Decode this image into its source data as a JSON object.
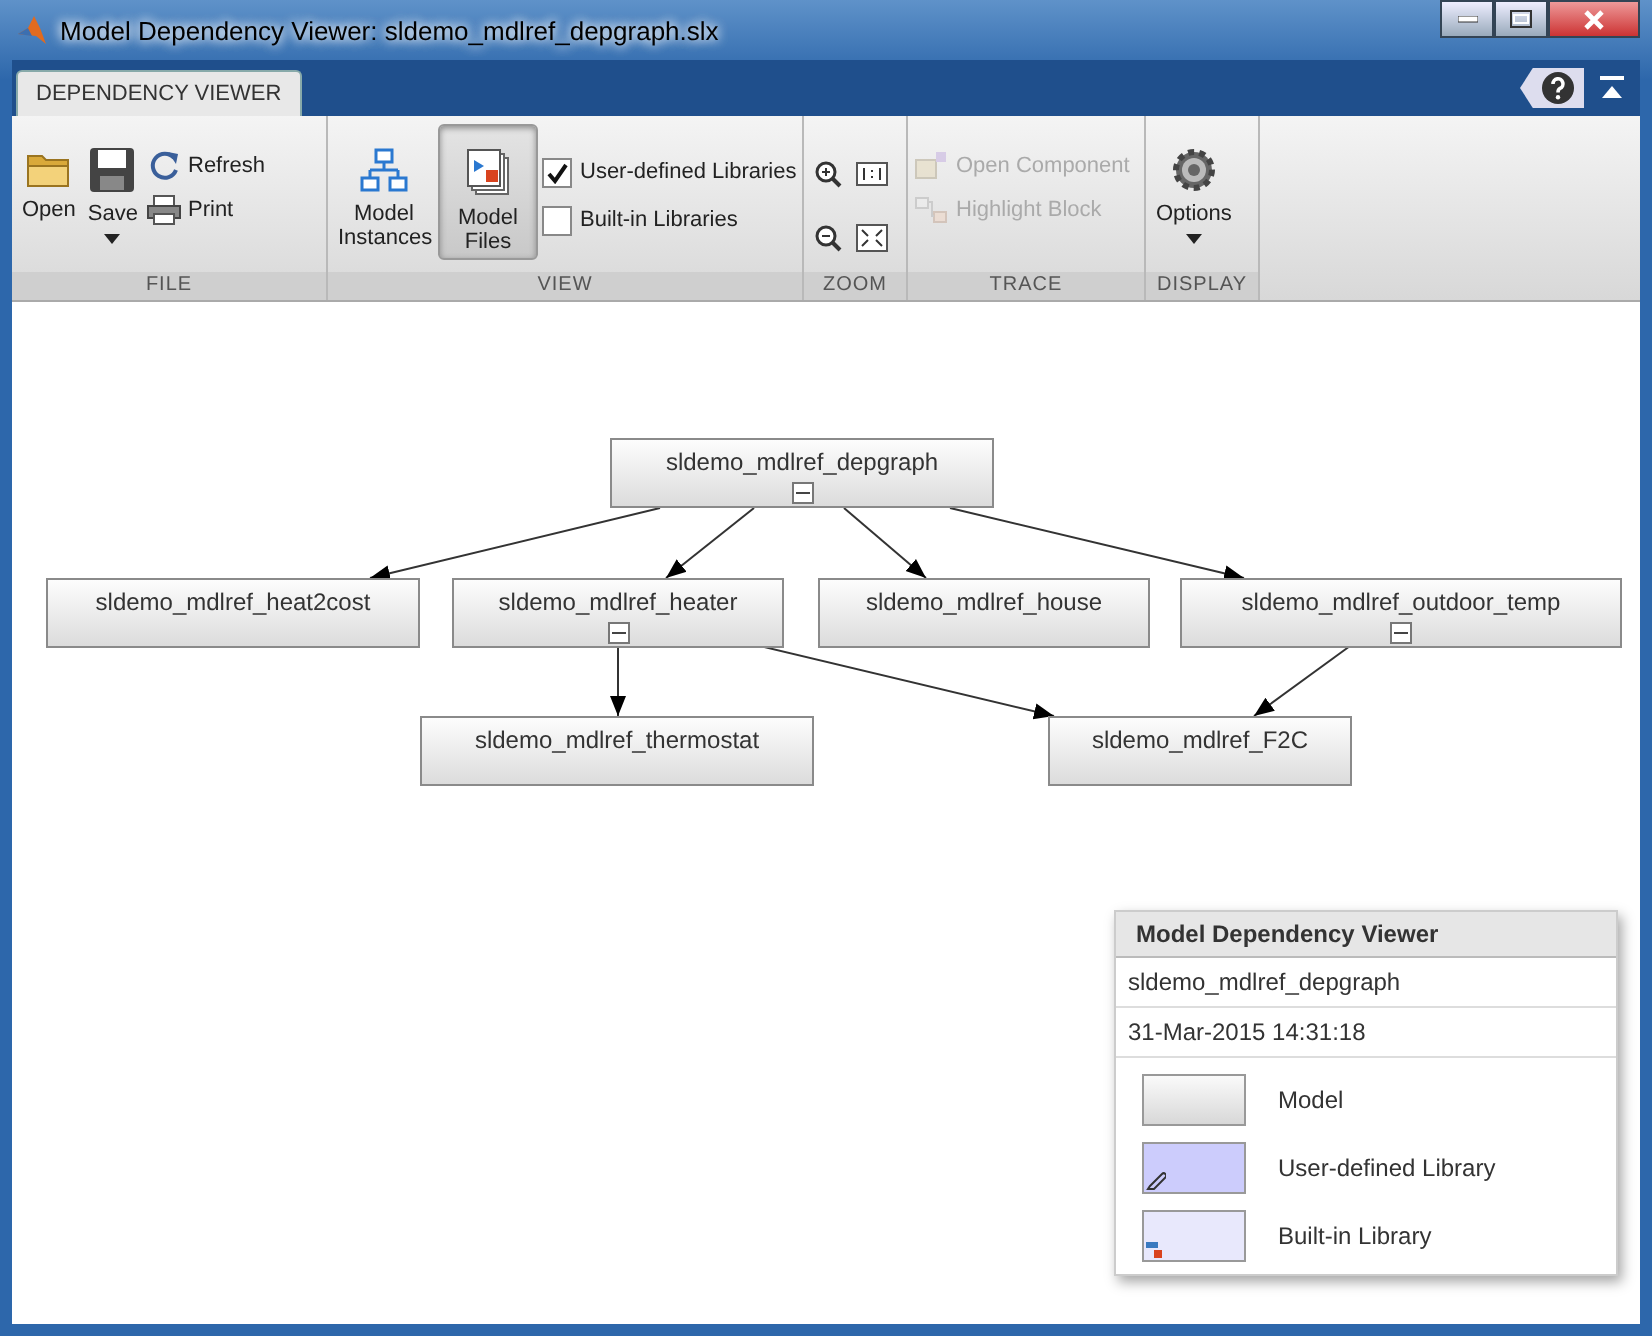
{
  "window": {
    "title": "Model Dependency Viewer: sldemo_mdlref_depgraph.slx"
  },
  "tabs": [
    {
      "label": "DEPENDENCY VIEWER",
      "selected": true
    }
  ],
  "ribbon": {
    "groups": [
      {
        "label": "FILE",
        "items": [
          {
            "kind": "large",
            "label": "Open"
          },
          {
            "kind": "large",
            "label": "Save",
            "dropdown": true
          },
          {
            "kind": "small",
            "label": "Refresh"
          },
          {
            "kind": "small",
            "label": "Print"
          }
        ]
      },
      {
        "label": "VIEW",
        "items": [
          {
            "kind": "large",
            "label": "Model Instances",
            "selected": false
          },
          {
            "kind": "large",
            "label": "Model Files",
            "selected": true
          },
          {
            "kind": "check",
            "label": "User-defined Libraries",
            "checked": true
          },
          {
            "kind": "check",
            "label": "Built-in Libraries",
            "checked": false
          }
        ]
      },
      {
        "label": "ZOOM"
      },
      {
        "label": "TRACE",
        "items": [
          {
            "kind": "small",
            "label": "Open Component",
            "disabled": true
          },
          {
            "kind": "small",
            "label": "Highlight Block",
            "disabled": true
          }
        ]
      },
      {
        "label": "DISPLAY",
        "items": [
          {
            "kind": "large",
            "label": "Options",
            "dropdown": true
          }
        ]
      }
    ]
  },
  "graph": {
    "nodes": [
      {
        "name": "sldemo_mdlref_depgraph",
        "collapsible": true
      },
      {
        "name": "sldemo_mdlref_heat2cost",
        "collapsible": false
      },
      {
        "name": "sldemo_mdlref_heater",
        "collapsible": true
      },
      {
        "name": "sldemo_mdlref_house",
        "collapsible": false
      },
      {
        "name": "sldemo_mdlref_outdoor_temp",
        "collapsible": true
      },
      {
        "name": "sldemo_mdlref_thermostat",
        "collapsible": false
      },
      {
        "name": "sldemo_mdlref_F2C",
        "collapsible": false
      }
    ]
  },
  "legend": {
    "title": "Model Dependency Viewer",
    "model": "sldemo_mdlref_depgraph",
    "timestamp": "31-Mar-2015 14:31:18",
    "items": [
      {
        "kind": "model",
        "label": "Model"
      },
      {
        "kind": "user",
        "label": "User-defined Library"
      },
      {
        "kind": "builtin",
        "label": "Built-in Library"
      }
    ]
  }
}
